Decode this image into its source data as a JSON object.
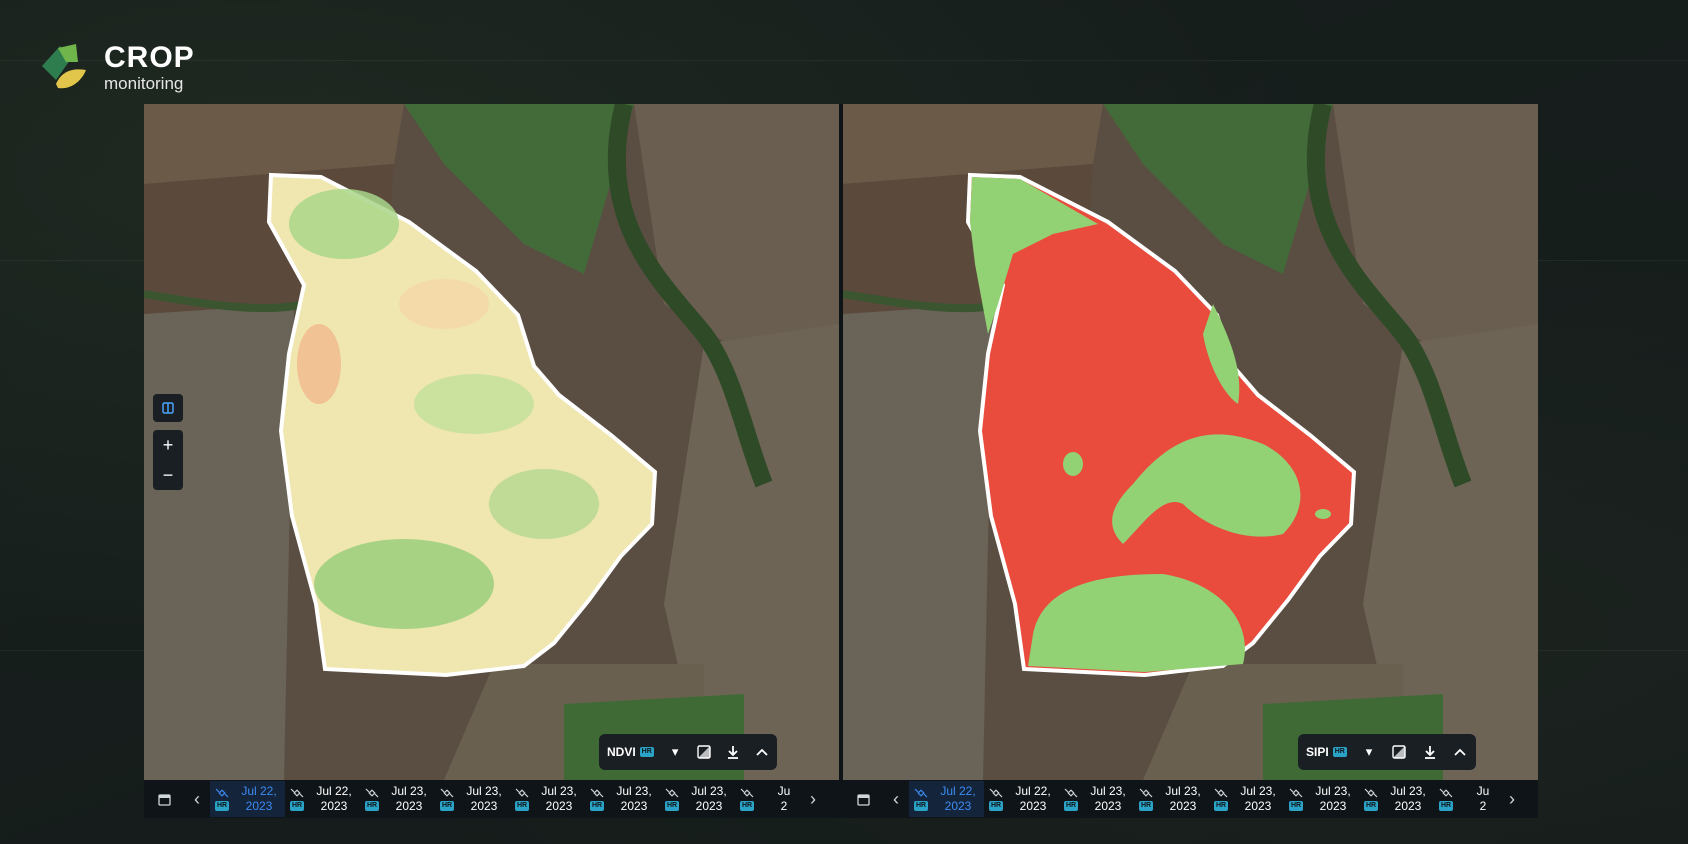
{
  "logo": {
    "title": "CROP",
    "subtitle": "monitoring",
    "colors": [
      "#2e7d4f",
      "#6fb54c",
      "#e2c64b"
    ]
  },
  "map_controls": {
    "split_icon": "split-view-icon",
    "zoom_in": "+",
    "zoom_out": "−"
  },
  "panels": [
    {
      "layer": {
        "name": "NDVI",
        "badge": "HR",
        "icons": [
          "chevron-down-icon",
          "image-compare-icon",
          "download-icon",
          "chevron-up-icon"
        ]
      },
      "overlay_colors": [
        "#f2e7b2",
        "#a6d68a",
        "#7cc46a",
        "#f0b98a"
      ],
      "timeline": {
        "dates": [
          {
            "line1": "Jul 22,",
            "line2": "2023",
            "badge": "HR",
            "active": true
          },
          {
            "line1": "Jul 22,",
            "line2": "2023",
            "badge": "HR",
            "active": false
          },
          {
            "line1": "Jul 23,",
            "line2": "2023",
            "badge": "HR",
            "active": false
          },
          {
            "line1": "Jul 23,",
            "line2": "2023",
            "badge": "HR",
            "active": false
          },
          {
            "line1": "Jul 23,",
            "line2": "2023",
            "badge": "HR",
            "active": false
          },
          {
            "line1": "Jul 23,",
            "line2": "2023",
            "badge": "HR",
            "active": false
          },
          {
            "line1": "Jul 23,",
            "line2": "2023",
            "badge": "HR",
            "active": false
          },
          {
            "line1": "Ju",
            "line2": "2",
            "badge": "HR",
            "active": false
          }
        ]
      }
    },
    {
      "layer": {
        "name": "SIPI",
        "badge": "HR",
        "icons": [
          "chevron-down-icon",
          "image-compare-icon",
          "download-icon",
          "chevron-up-icon"
        ]
      },
      "overlay_colors": [
        "#e94b3c",
        "#93d175"
      ],
      "timeline": {
        "dates": [
          {
            "line1": "Jul 22,",
            "line2": "2023",
            "badge": "HR",
            "active": true
          },
          {
            "line1": "Jul 22,",
            "line2": "2023",
            "badge": "HR",
            "active": false
          },
          {
            "line1": "Jul 23,",
            "line2": "2023",
            "badge": "HR",
            "active": false
          },
          {
            "line1": "Jul 23,",
            "line2": "2023",
            "badge": "HR",
            "active": false
          },
          {
            "line1": "Jul 23,",
            "line2": "2023",
            "badge": "HR",
            "active": false
          },
          {
            "line1": "Jul 23,",
            "line2": "2023",
            "badge": "HR",
            "active": false
          },
          {
            "line1": "Jul 23,",
            "line2": "2023",
            "badge": "HR",
            "active": false
          },
          {
            "line1": "Ju",
            "line2": "2",
            "badge": "HR",
            "active": false
          }
        ]
      }
    }
  ]
}
